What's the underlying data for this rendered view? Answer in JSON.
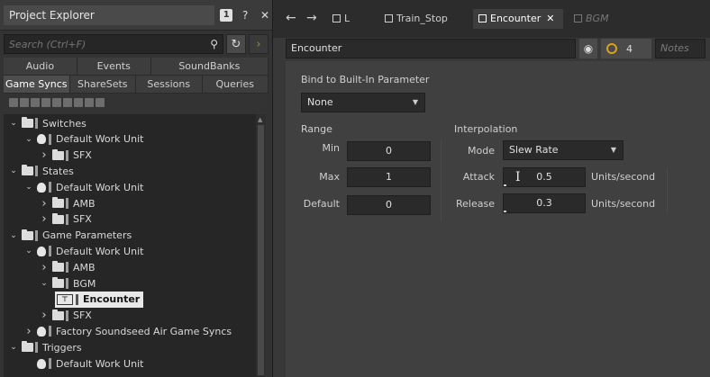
{
  "explorer": {
    "title": "Project Explorer",
    "badge": "1",
    "search_placeholder": "Search (Ctrl+F)",
    "tabs_top": [
      "Audio",
      "Events",
      "SoundBanks"
    ],
    "tabs_bottom": [
      "Game Syncs",
      "ShareSets",
      "Sessions",
      "Queries"
    ],
    "active_tab": "Game Syncs",
    "tree": [
      {
        "label": "Switches",
        "indent": 0,
        "kind": "folder",
        "expanded": true
      },
      {
        "label": "Default Work Unit",
        "indent": 1,
        "kind": "workunit",
        "expanded": true
      },
      {
        "label": "SFX",
        "indent": 2,
        "kind": "folder",
        "expanded": false
      },
      {
        "label": "States",
        "indent": 0,
        "kind": "folder",
        "expanded": true
      },
      {
        "label": "Default Work Unit",
        "indent": 1,
        "kind": "workunit",
        "expanded": true
      },
      {
        "label": "AMB",
        "indent": 2,
        "kind": "folder",
        "expanded": false
      },
      {
        "label": "SFX",
        "indent": 2,
        "kind": "folder",
        "expanded": false
      },
      {
        "label": "Game Parameters",
        "indent": 0,
        "kind": "folder",
        "expanded": true
      },
      {
        "label": "Default Work Unit",
        "indent": 1,
        "kind": "workunit",
        "expanded": true
      },
      {
        "label": "AMB",
        "indent": 2,
        "kind": "folder",
        "expanded": false
      },
      {
        "label": "BGM",
        "indent": 2,
        "kind": "folder",
        "expanded": true
      },
      {
        "label": "Encounter",
        "indent": 3,
        "kind": "param",
        "selected": true
      },
      {
        "label": "SFX",
        "indent": 2,
        "kind": "folder",
        "expanded": false
      },
      {
        "label": "Factory Soundseed Air Game Syncs",
        "indent": 1,
        "kind": "workunit",
        "expanded": false
      },
      {
        "label": "Triggers",
        "indent": 0,
        "kind": "folder",
        "expanded": true
      },
      {
        "label": "Default Work Unit",
        "indent": 1,
        "kind": "workunit",
        "expanded": null
      }
    ]
  },
  "editor": {
    "tabs": [
      {
        "label": "L",
        "state": "normal"
      },
      {
        "label": "Train_Stop",
        "state": "normal"
      },
      {
        "label": "Encounter",
        "state": "active"
      },
      {
        "label": "BGM",
        "state": "dim"
      }
    ],
    "object_name": "Encounter",
    "ref_count": "4",
    "notes_placeholder": "Notes",
    "bind_label": "Bind to Built-In Parameter",
    "bind_value": "None",
    "range": {
      "title": "Range",
      "min_label": "Min",
      "min": "0",
      "max_label": "Max",
      "max": "1",
      "default_label": "Default",
      "default": "0"
    },
    "interpolation": {
      "title": "Interpolation",
      "mode_label": "Mode",
      "mode": "Slew Rate",
      "attack_label": "Attack",
      "attack": "0.5",
      "release_label": "Release",
      "release": "0.3",
      "units": "Units/second"
    }
  }
}
